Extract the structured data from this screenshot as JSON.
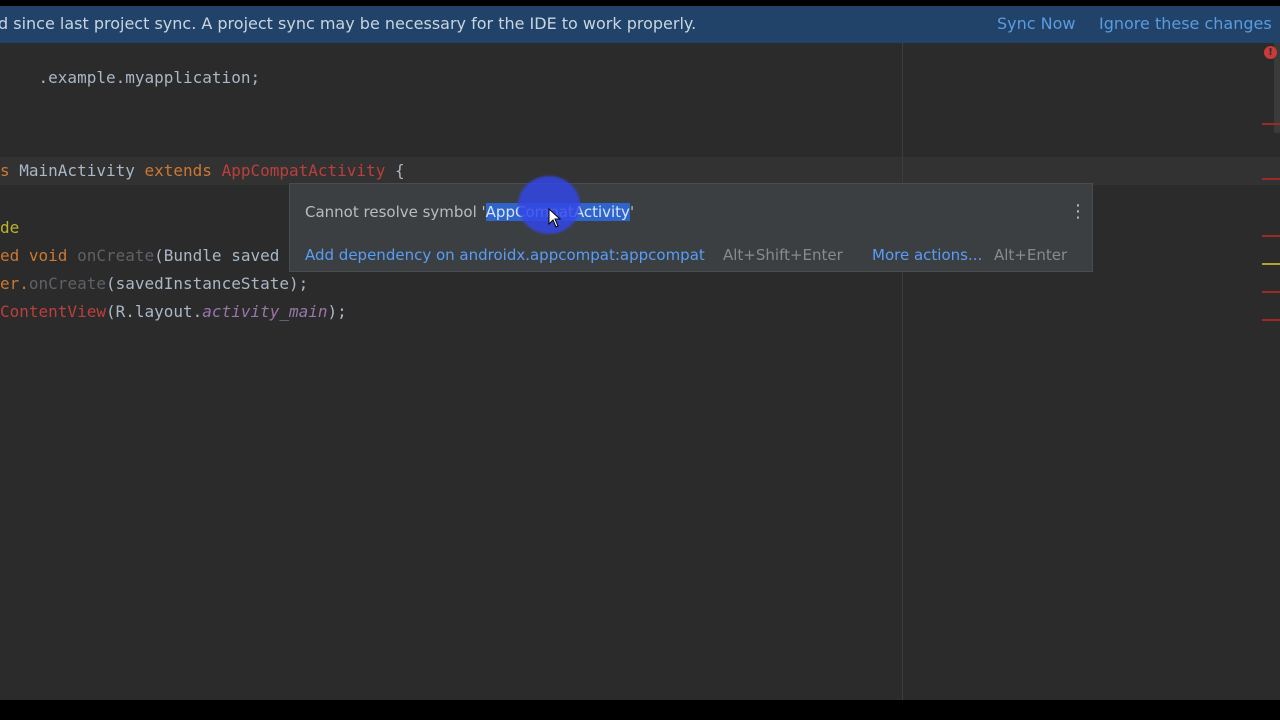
{
  "banner": {
    "message": "d since last project sync. A project sync may be necessary for the IDE to work properly.",
    "sync_now": "Sync Now",
    "ignore": "Ignore these changes"
  },
  "code": {
    "line1": ".example.myapplication;",
    "line2_kw1": "s ",
    "line2_class": "MainActivity ",
    "line2_kw2": "extends ",
    "line2_super": "AppCompatActivity",
    "line2_brace": " {",
    "line3": "de",
    "line4_kw": "ed void ",
    "line4_fn": "onCreate",
    "line4_rest": "(Bundle saved",
    "line5_a": "er.",
    "line5_fn": "onCreate",
    "line5_b": "(savedInstanceState);",
    "line6_fn": "ContentView",
    "line6_a": "(R.layout.",
    "line6_it": "activity_main",
    "line6_b": ");"
  },
  "popup": {
    "title_prefix": "Cannot resolve symbol '",
    "symbol": "AppCompatActivity",
    "title_suffix": "'",
    "kebab": "⋮",
    "action_add": "Add dependency on androidx.appcompat:appcompat",
    "shortcut_add": "Alt+Shift+Enter",
    "action_more": "More actions...",
    "shortcut_more": "Alt+Enter"
  },
  "indicator": {
    "error_glyph": "!"
  },
  "colors": {
    "banner_bg": "#21436a",
    "editor_bg": "#2b2b2b",
    "link": "#5b9bde",
    "error_stripe": "#9e2927",
    "warning_stripe": "#b5a22c"
  }
}
